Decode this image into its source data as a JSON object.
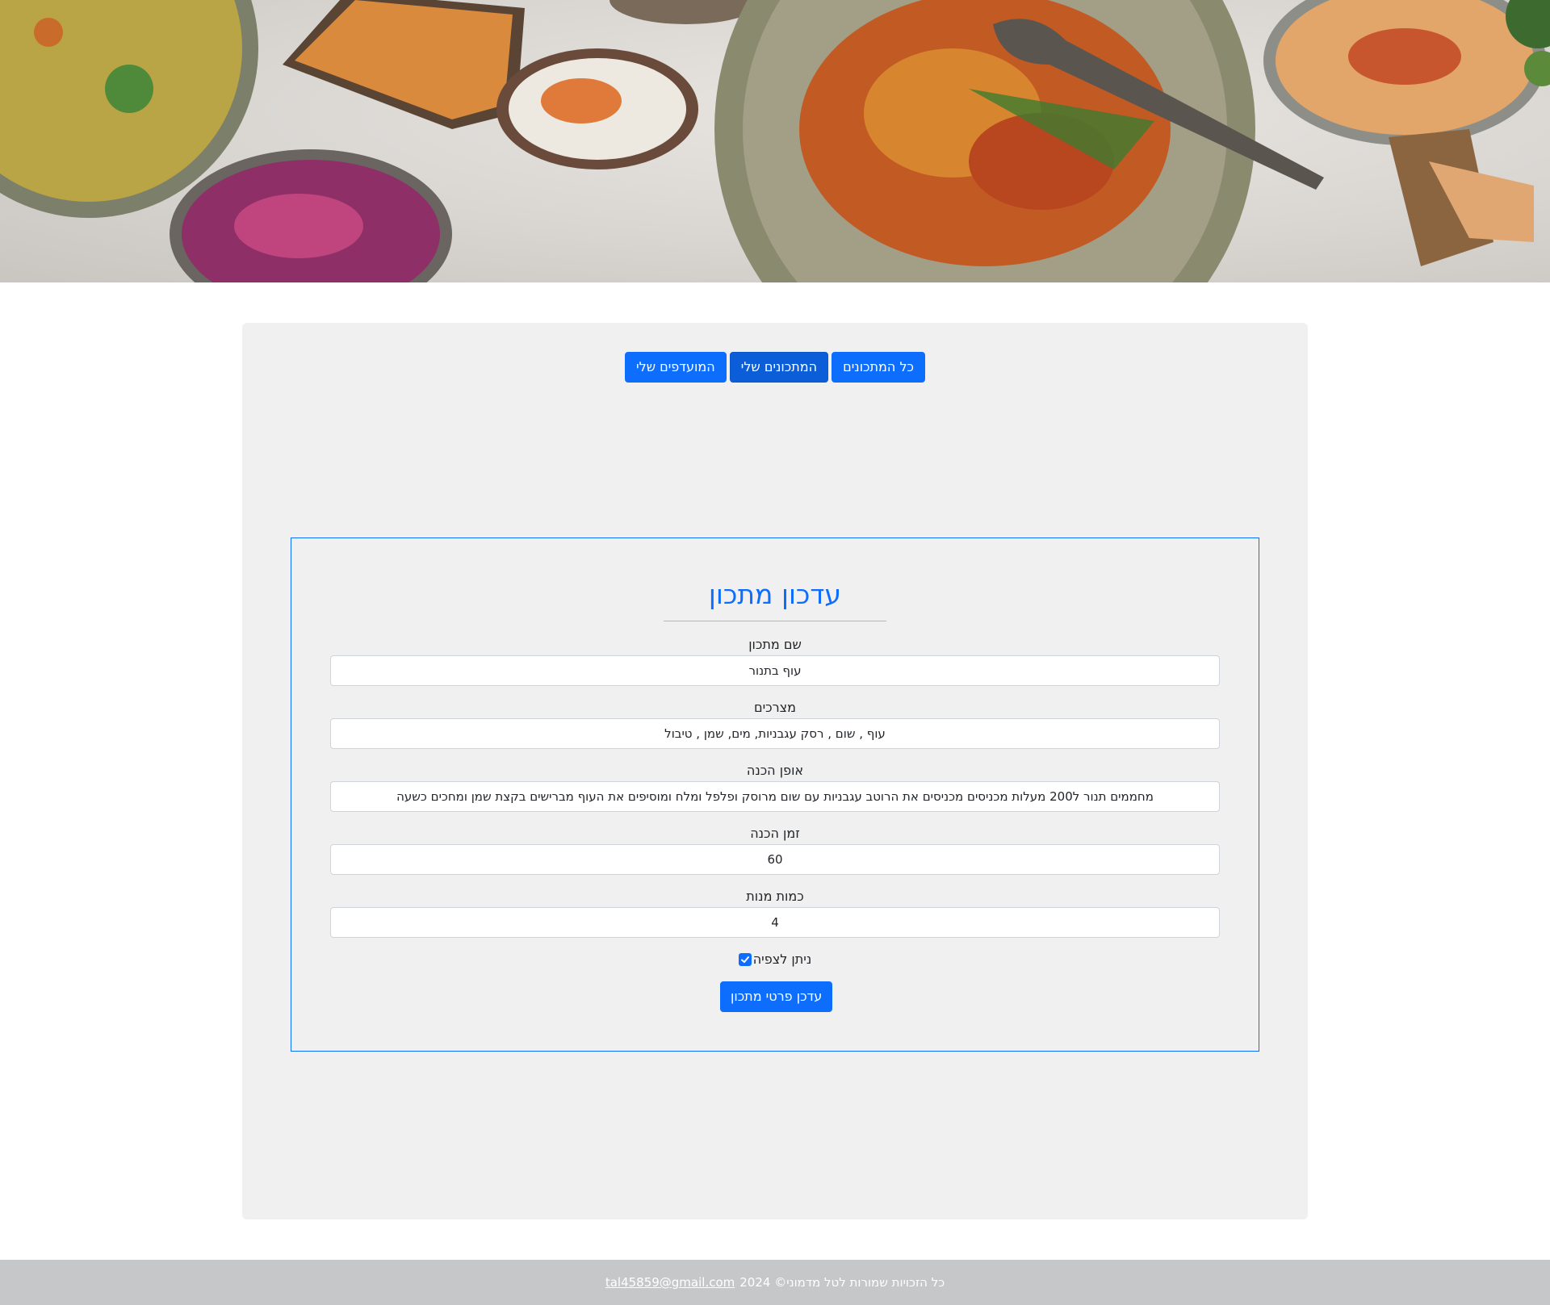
{
  "hero": {
    "image": "food-spread-photo"
  },
  "tabs": [
    {
      "label": "כל המתכונים",
      "active": false
    },
    {
      "label": "המתכונים שלי",
      "active": true
    },
    {
      "label": "המועדפים שלי",
      "active": false
    }
  ],
  "form": {
    "title": "עדכון מתכון",
    "fields": {
      "name": {
        "label": "שם מתכון",
        "value": "עוף בתנור"
      },
      "ingredients": {
        "label": "מצרכים",
        "value": "עוף , שום , רסק עגבניות, מים, שמן , טיבול"
      },
      "method": {
        "label": "אופן הכנה",
        "value": "מחממים תנור ל200 מעלות מכניסים מכניסים את הרוטב עגבניות עם שום מרוסק ופלפל ומלח ומוסיפים את העוף מברישים בקצת שמן ומחכים כשעה"
      },
      "prep_time": {
        "label": "זמן הכנה",
        "value": "60"
      },
      "servings": {
        "label": "כמות מנות",
        "value": "4"
      }
    },
    "visible_checkbox": {
      "label": "ניתן לצפיה",
      "checked": true
    },
    "submit_label": "עדכן פרטי מתכון"
  },
  "footer": {
    "text": "כל הזכויות שמורות לטל מדמוני© 2024",
    "email": "tal45859@gmail.com"
  },
  "colors": {
    "primary": "#0d6efd",
    "primary_active": "#0b5ed7",
    "panel_bg": "#f0f0f0",
    "footer_bg": "#c6c7c9"
  }
}
